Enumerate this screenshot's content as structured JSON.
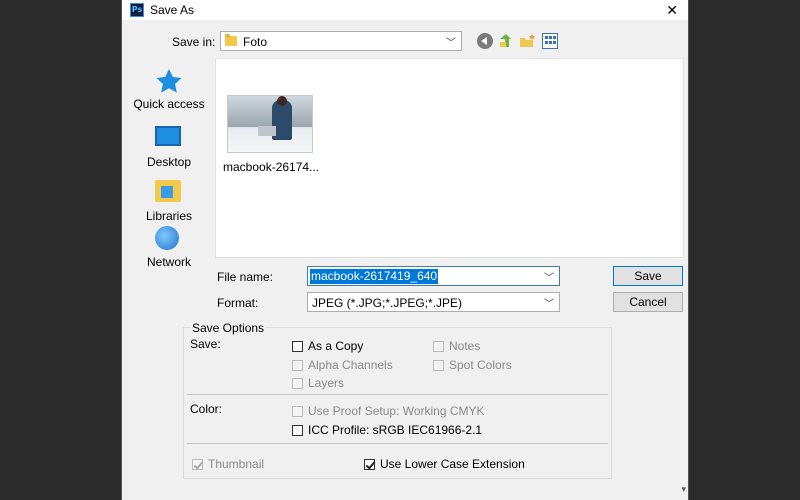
{
  "window": {
    "title": "Save As",
    "close_glyph": "✕",
    "app_icon_text": "Ps"
  },
  "location": {
    "label": "Save in:",
    "value": "Foto"
  },
  "places": [
    {
      "label": "Quick access",
      "icon": "star-icon"
    },
    {
      "label": "Desktop",
      "icon": "desktop-icon"
    },
    {
      "label": "Libraries",
      "icon": "libraries-icon"
    },
    {
      "label": "Network",
      "icon": "network-icon"
    }
  ],
  "files": [
    {
      "name": "macbook-26174..."
    }
  ],
  "filename": {
    "label": "File name:",
    "value": "macbook-2617419_640"
  },
  "format": {
    "label": "Format:",
    "value": "JPEG (*.JPG;*.JPEG;*.JPE)"
  },
  "buttons": {
    "save": "Save",
    "cancel": "Cancel"
  },
  "options": {
    "title": "Save Options",
    "save_label": "Save:",
    "as_copy": "As a Copy",
    "notes": "Notes",
    "alpha": "Alpha Channels",
    "spot": "Spot Colors",
    "layers": "Layers",
    "color_label": "Color:",
    "proof": "Use Proof Setup:  Working CMYK",
    "icc": "ICC Profile:  sRGB IEC61966-2.1",
    "thumbnail": "Thumbnail",
    "lowercase": "Use Lower Case Extension"
  },
  "colors": {
    "accent": "#0078d7",
    "folder": "#f2c94c"
  }
}
